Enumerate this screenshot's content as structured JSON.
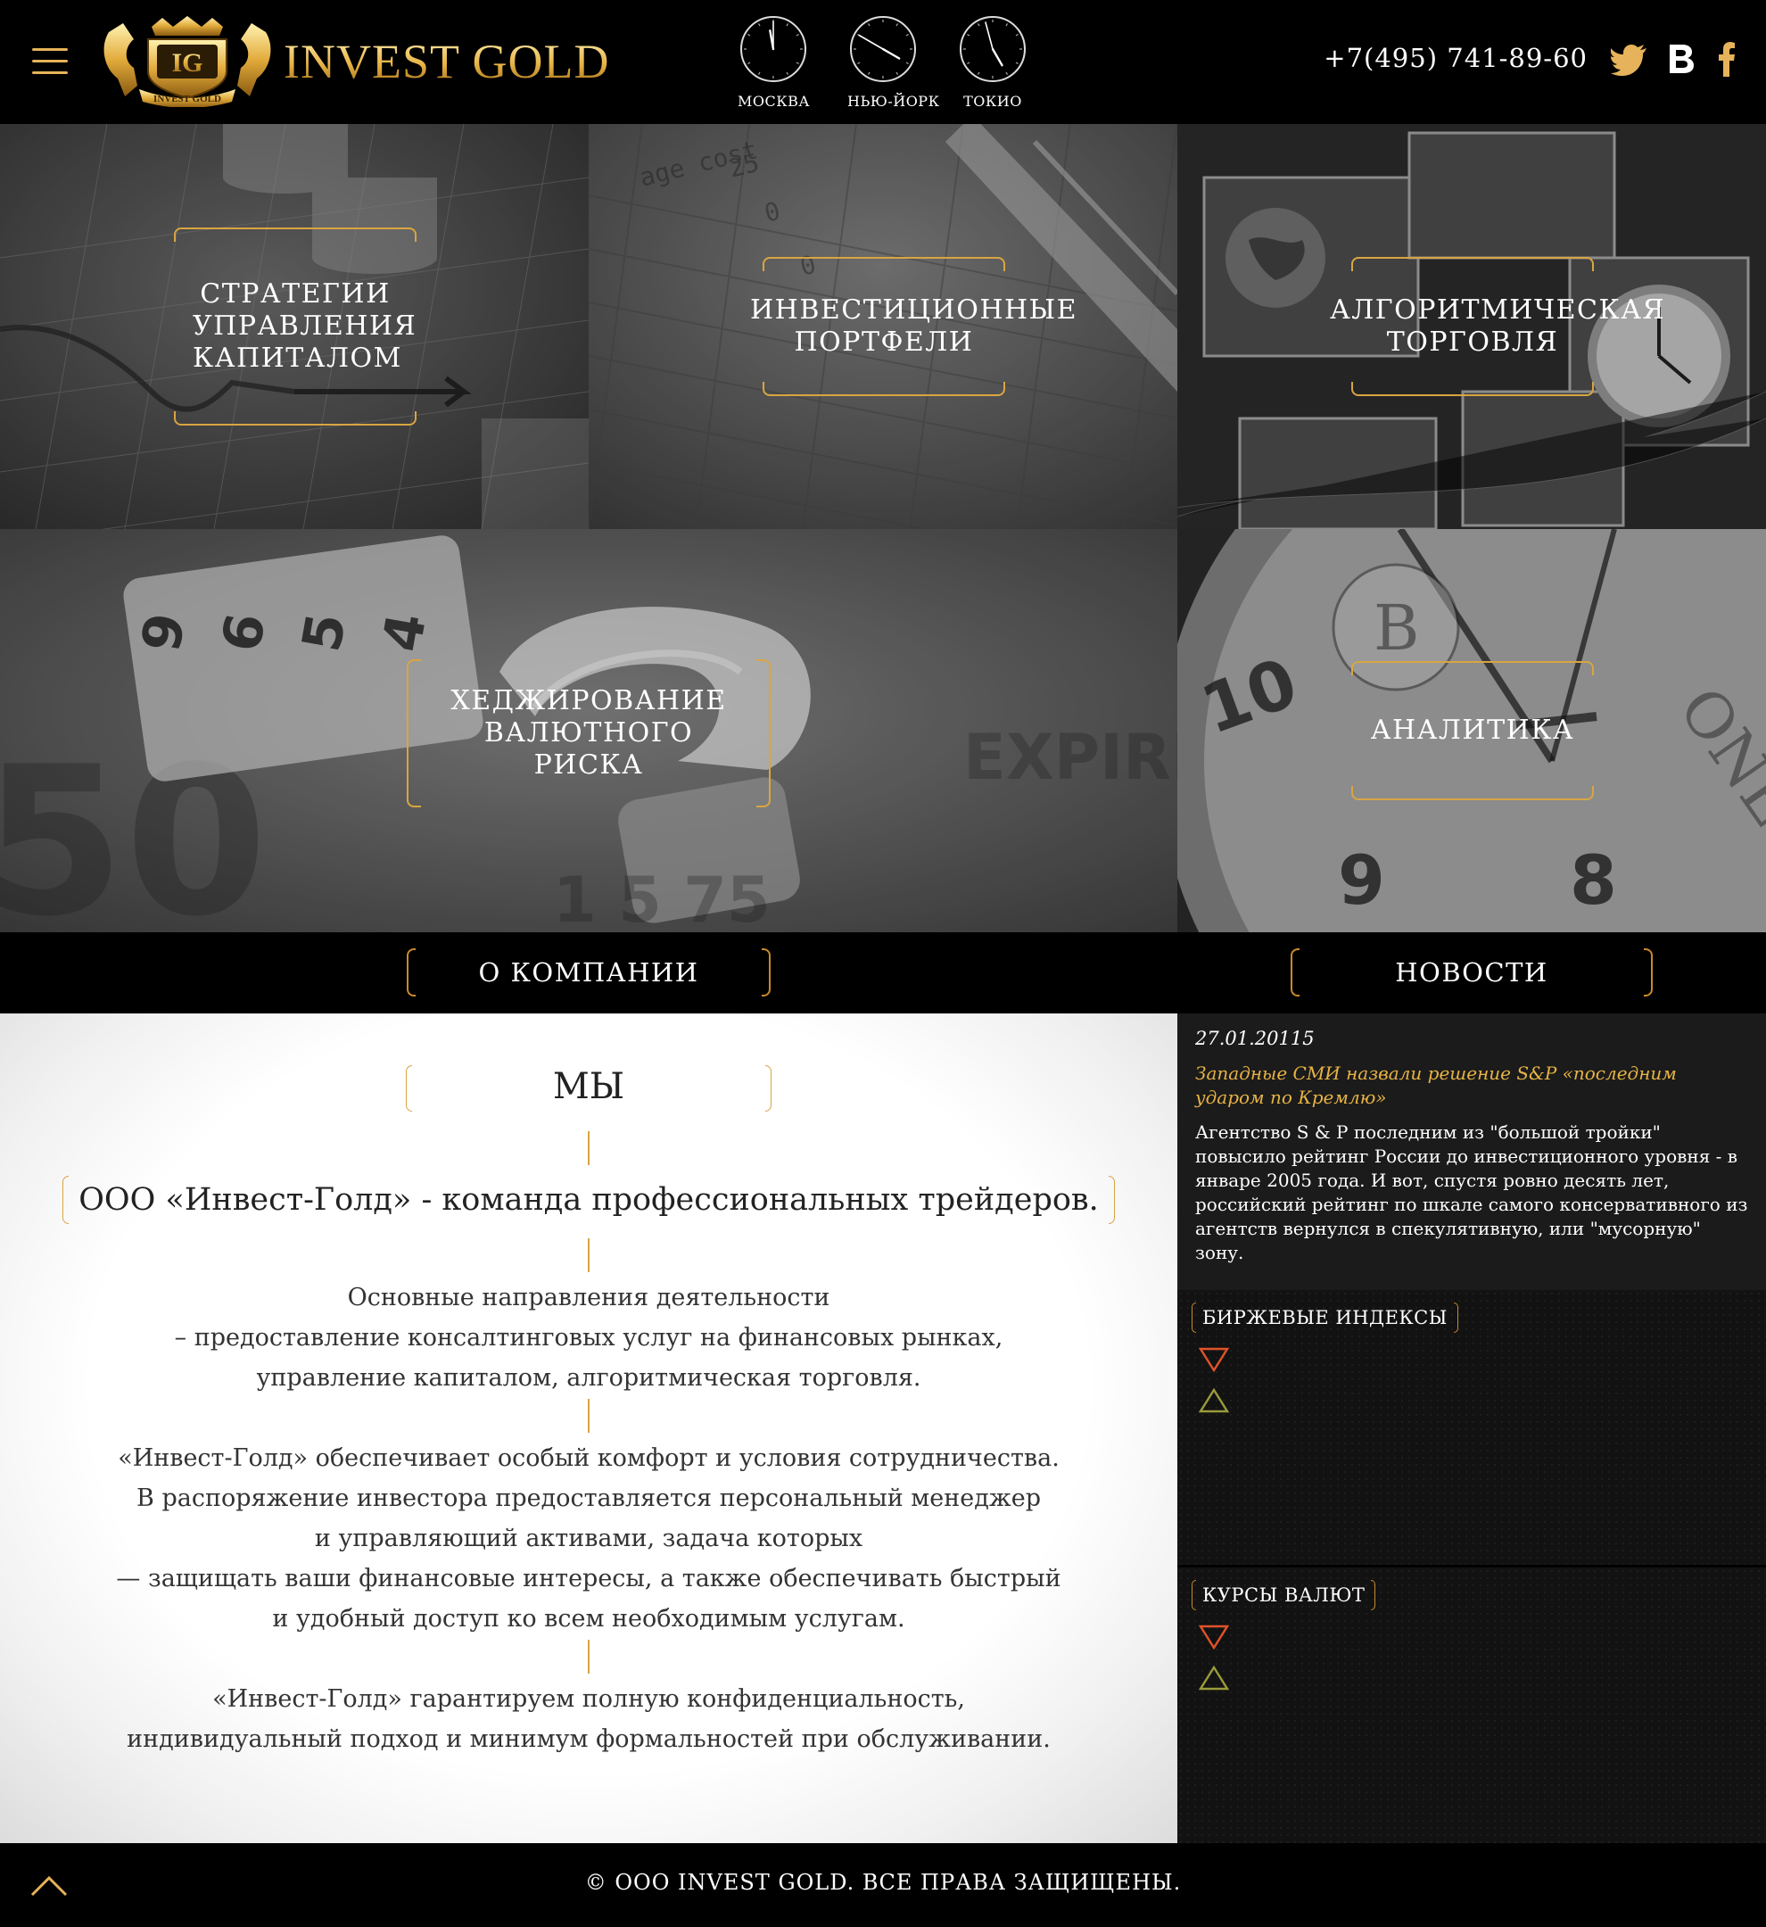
{
  "header": {
    "brand": "INVEST GOLD",
    "logo_mark": "IG",
    "logo_sub": "INVEST GOLD",
    "phone": "+7(495) 741-89-60",
    "clocks": [
      {
        "city": "МОСКВА",
        "hour_angle": 350,
        "minute_angle": 0
      },
      {
        "city": "НЬЮ-ЙОРК",
        "hour_angle": 120,
        "minute_angle": 300
      },
      {
        "city": "ТОКИО",
        "hour_angle": 150,
        "minute_angle": 345
      }
    ],
    "accent": "#e6b35a"
  },
  "tiles": [
    {
      "label": "СТРАТЕГИИ УПРАВЛЕНИЯ КАПИТАЛОМ"
    },
    {
      "label": "ИНВЕСТИЦИОННЫЕ ПОРТФЕЛИ"
    },
    {
      "label": "АЛГОРИТМИЧЕСКАЯ ТОРГОВЛЯ"
    },
    {
      "label": "ХЕДЖИРОВАНИЕ ВАЛЮТНОГО РИСКА"
    },
    {
      "label": "АНАЛИТИКА"
    }
  ],
  "sections": {
    "about": "О КОМПАНИИ",
    "news": "НОВОСТИ"
  },
  "about": {
    "title": "МЫ",
    "lead": "ООО «Инвест-Голд» - команда профессиональных трейдеров.",
    "p1": [
      "Основные направления деятельности",
      "– предоставление консалтинговых услуг на финансовых рынках,",
      "управление капиталом, алгоритмическая торговля."
    ],
    "p2": [
      "«Инвест-Голд» обеспечивает особый комфорт и условия сотрудничества.",
      "В распоряжение инвестора предоставляется персональный менеджер",
      "и управляющий активами, задача которых",
      "— защищать ваши финансовые интересы, а также обеспечивать быстрый",
      "и удобный доступ ко всем необходимым услугам."
    ],
    "p3": [
      "«Инвест-Голд» гарантируем полную конфиденциальность,",
      "индивидуальный подход и минимум формальностей при обслуживании."
    ]
  },
  "news": {
    "date": "27.01.20115",
    "headline": "Западные СМИ назвали решение S&P «последним ударом по Кремлю»",
    "body": "Агентство S & P последним из \"большой тройки\" повысило рейтинг России до инвестиционного уровня - в январе 2005 года. И вот, спустя ровно десять лет, российский рейтинг по шкале самого консервативного из агентств вернулся в спекулятивную, или \"мусорную\" зону."
  },
  "indices": {
    "label": "БИРЖЕВЫЕ ИНДЕКСЫ"
  },
  "rates": {
    "label": "КУРСЫ ВАЛЮТ"
  },
  "footer": {
    "copyright": "© ООО INVEST GOLD. ВСЕ ПРАВА ЗАЩИЩЕНЫ."
  },
  "icons": {
    "up": "chevron-up-icon",
    "down_trend": "triangle-down-icon",
    "up_trend": "triangle-up-icon",
    "twitter": "twitter-icon",
    "vk": "vk-icon",
    "facebook": "facebook-icon",
    "menu": "menu-icon"
  }
}
